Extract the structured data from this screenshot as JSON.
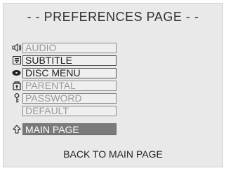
{
  "header": {
    "title": "- - PREFERENCES PAGE - -"
  },
  "menu": {
    "items": [
      {
        "label": "AUDIO",
        "icon": "speaker-icon",
        "state": "disabled"
      },
      {
        "label": "SUBTITLE",
        "icon": "subtitle-icon",
        "state": "enabled"
      },
      {
        "label": "DISC MENU",
        "icon": "disc-menu-icon",
        "state": "enabled"
      },
      {
        "label": "PARENTAL",
        "icon": "parental-lock-icon",
        "state": "disabled"
      },
      {
        "label": "PASSWORD",
        "icon": "key-icon",
        "state": "disabled"
      },
      {
        "label": "DEFAULT",
        "icon": "",
        "state": "disabled"
      }
    ]
  },
  "main_page": {
    "label": "MAIN PAGE",
    "icon": "up-arrow-icon",
    "selected": true
  },
  "footer": {
    "hint": "BACK TO MAIN PAGE"
  },
  "colors": {
    "background": "#e9e9e9",
    "highlight": "#7a7a7a",
    "disabled_text": "#9a9a9a",
    "enabled_text": "#1e1e1e"
  }
}
